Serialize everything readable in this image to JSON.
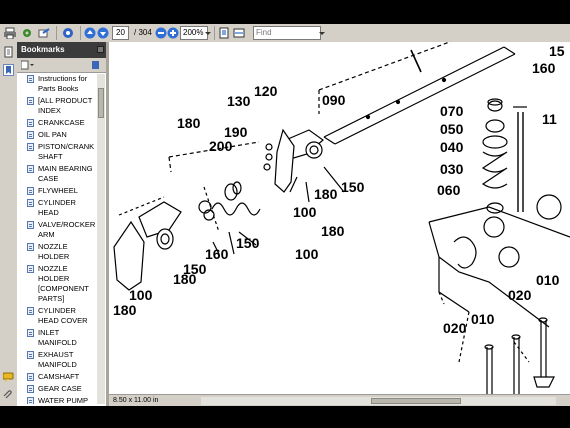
{
  "toolbar": {
    "page_number": "20",
    "page_total": "/ 304",
    "zoom": "200%",
    "find_placeholder": "Find"
  },
  "bookmarks_panel": {
    "title": "Bookmarks",
    "items": [
      "Instructions for Parts Books",
      "[ALL PRODUCT INDEX",
      "CRANKCASE",
      "OIL PAN",
      "PISTON/CRANK SHAFT",
      "MAIN BEARING CASE",
      "FLYWHEEL",
      "CYLINDER HEAD",
      "VALVE/ROCKER ARM",
      "NOZZLE HOLDER",
      "NOZZLE HOLDER [COMPONENT PARTS]",
      "CYLINDER HEAD COVER",
      "INLET MANIFOLD",
      "EXHAUST MANIFOLD",
      "CAMSHAFT",
      "GEAR CASE",
      "WATER PUMP"
    ]
  },
  "status": {
    "page_size": "8.50 x 11.00 in"
  },
  "diagram": {
    "callouts": [
      "180",
      "120",
      "130",
      "090",
      "190",
      "200",
      "180",
      "150",
      "100",
      "070",
      "050",
      "040",
      "030",
      "060",
      "11",
      "15",
      "160",
      "180",
      "150",
      "160",
      "150",
      "100",
      "180",
      "010",
      "020",
      "020",
      "010",
      "100",
      "180"
    ]
  }
}
